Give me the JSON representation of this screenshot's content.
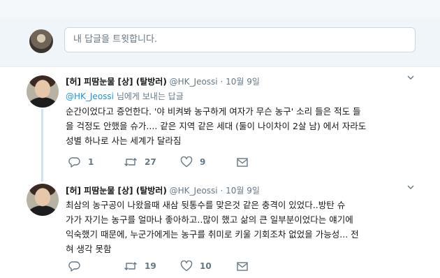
{
  "reply_box": {
    "placeholder": "내 답글을 트윗합니다."
  },
  "tweets": [
    {
      "name": "[허] 피땀눈물 [상] (탈방러)",
      "handle": "@HK_Jeossi",
      "separator": "·",
      "time": "10월 9일",
      "reply_to": {
        "mention": "@HK_Jeossi",
        "suffix": " 님에게 보내는 답글"
      },
      "lines": [
        "순간이었다고 증언한다. '야 비켜봐 농구하게 여자가 무슨 농구' 소리 들은 적도 들",
        "을 걱정도 안했을 슈가.... 같은 지역 같은 세대 (둘이 나이차이 2살 남) 에서 자라도",
        "성별 하나로 사는 세계가 달라짐"
      ],
      "replies": "1",
      "retweets": "27",
      "likes": "9"
    },
    {
      "name": "[허] 피땀눈물 [상] (탈방러)",
      "handle": "@HK_Jeossi",
      "separator": "·",
      "time": "10월 9일",
      "lines": [
        "최삼의 농구공이 나왔을때 새삼 뒷통수를 맞은것 같은 충격이 있었다..방탄 슈",
        "가가 자기는 농구를 얼마나 좋아하고..많이 했고 삶의 큰 일부분이었다는 얘기에",
        "익숙했기 때문에, 누군가에게는 농구를 취미로 키울 기회조차 없었을 가능성... 전",
        "혀 생각 못함"
      ],
      "replies": "",
      "retweets": "19",
      "likes": "10"
    }
  ],
  "icons": {
    "reply": "reply-icon",
    "retweet": "retweet-icon",
    "like": "heart-icon",
    "dm": "envelope-icon",
    "menu": "chevron-down-icon"
  },
  "colors": {
    "link": "#1b95e0",
    "muted": "#657786",
    "text": "#14171a",
    "thread_line": "#cde3f5"
  }
}
